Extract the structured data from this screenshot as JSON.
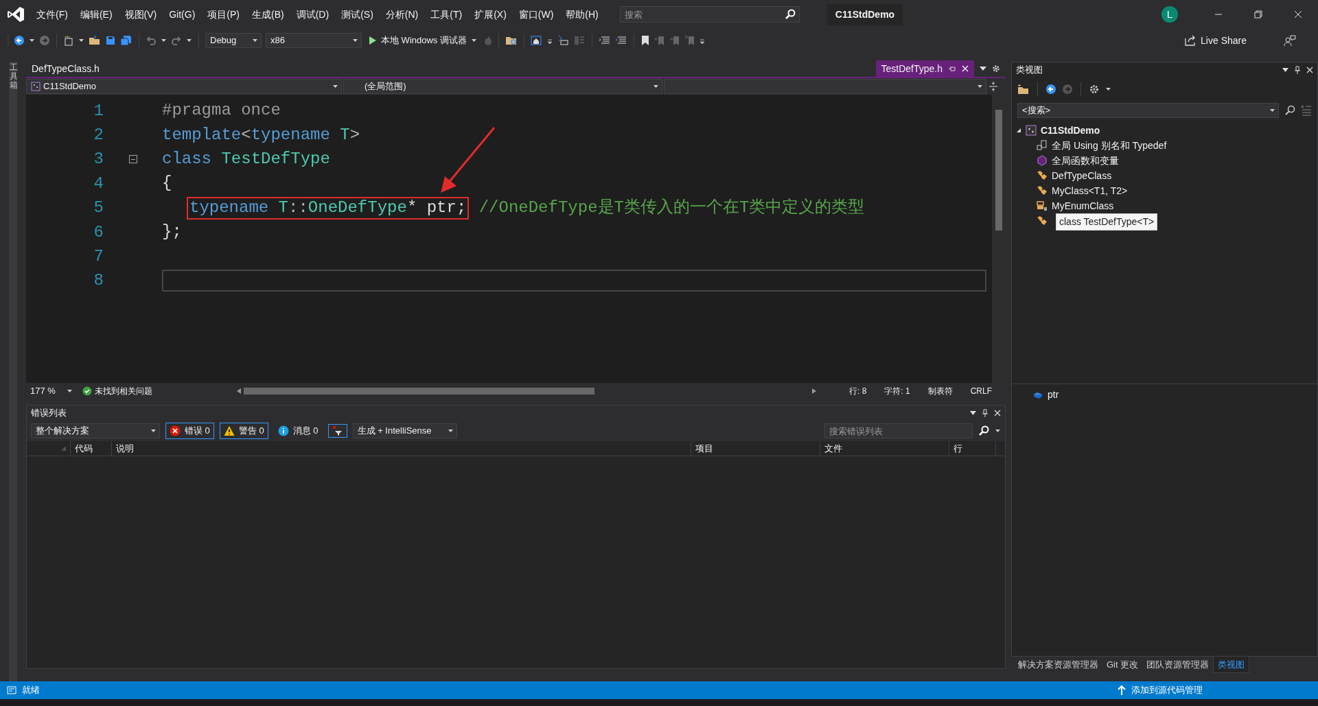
{
  "menu": [
    "文件(F)",
    "编辑(E)",
    "视图(V)",
    "Git(G)",
    "项目(P)",
    "生成(B)",
    "调试(D)",
    "测试(S)",
    "分析(N)",
    "工具(T)",
    "扩展(X)",
    "窗口(W)",
    "帮助(H)"
  ],
  "search": {
    "placeholder": "搜索"
  },
  "solution_title": "C11StdDemo",
  "account": {
    "initial": "L"
  },
  "toolbar": {
    "configuration": "Debug",
    "platform": "x86",
    "run_label": "本地 Windows 调试器",
    "live_share": "Live Share"
  },
  "toolbox_label": "工具箱",
  "editor": {
    "tabs": [
      {
        "label": "DefTypeClass.h",
        "selected": false
      },
      {
        "label": "TestDefType.h",
        "selected": true
      }
    ],
    "nav": [
      "C11StdDemo",
      "(全局范围)"
    ],
    "lines": [
      {
        "number": "1",
        "fold": false,
        "current": false,
        "segments": [
          {
            "boxed": false,
            "tokens": [
              {
                "text": "#pragma once",
                "kind": "pre"
              }
            ]
          }
        ]
      },
      {
        "number": "2",
        "fold": false,
        "current": false,
        "segments": [
          {
            "boxed": false,
            "tokens": [
              {
                "text": "template",
                "kind": "kw"
              },
              {
                "text": "<",
                "kind": "op"
              },
              {
                "text": "typename",
                "kind": "kw"
              },
              {
                "text": " T",
                "kind": "type"
              },
              {
                "text": ">",
                "kind": "op"
              }
            ]
          }
        ]
      },
      {
        "number": "3",
        "fold": true,
        "current": false,
        "segments": [
          {
            "boxed": false,
            "tokens": [
              {
                "text": "class",
                "kind": "kw"
              },
              {
                "text": " TestDefType",
                "kind": "type"
              }
            ]
          }
        ]
      },
      {
        "number": "4",
        "fold": false,
        "current": false,
        "segments": [
          {
            "boxed": false,
            "tokens": [
              {
                "text": "{",
                "kind": "plain"
              }
            ]
          }
        ]
      },
      {
        "number": "5",
        "fold": false,
        "current": false,
        "segments": [
          {
            "boxed": true,
            "tokens": [
              {
                "text": "typename",
                "kind": "kw"
              },
              {
                "text": " T",
                "kind": "type"
              },
              {
                "text": "::",
                "kind": "op"
              },
              {
                "text": "OneDefType",
                "kind": "type"
              },
              {
                "text": "* ptr;",
                "kind": "plain"
              }
            ]
          },
          {
            "boxed": false,
            "tokens": [
              {
                "text": " //OneDefType是T类传入的一个在T类中定义的类型",
                "kind": "comment"
              }
            ]
          }
        ]
      },
      {
        "number": "6",
        "fold": false,
        "current": false,
        "segments": [
          {
            "boxed": false,
            "tokens": [
              {
                "text": "};",
                "kind": "plain"
              }
            ]
          }
        ]
      },
      {
        "number": "7",
        "fold": false,
        "current": false
      },
      {
        "number": "8",
        "fold": false,
        "current": true
      }
    ],
    "zoom": "177 %",
    "issues": "未找到相关问题",
    "position": [
      "行: 8",
      "字符: 1",
      "制表符",
      "CRLF"
    ]
  },
  "error_list": {
    "title": "错误列表",
    "scope": "整个解决方案",
    "filters": [
      {
        "kind": "error",
        "label": "错误 0",
        "selected": true
      },
      {
        "kind": "warning",
        "label": "警告 0",
        "selected": true
      },
      {
        "kind": "info",
        "label": "消息 0",
        "selected": false
      }
    ],
    "source": "生成 + IntelliSense",
    "search": {
      "placeholder": "搜索错误列表"
    },
    "columns": [
      "代码",
      "说明",
      "项目",
      "文件",
      "行"
    ]
  },
  "class_view": {
    "title": "类视图",
    "search": "<搜索>",
    "tree": {
      "label": "C11StdDemo",
      "expanded": true,
      "children": [
        {
          "label": "全局 Using 别名和 Typedef",
          "kind": "typedef"
        },
        {
          "label": "全局函数和变量",
          "kind": "globals"
        },
        {
          "label": "DefTypeClass",
          "kind": "class"
        },
        {
          "label": "MyClass<T1, T2>",
          "kind": "class"
        },
        {
          "label": "MyEnumClass",
          "kind": "enum"
        },
        {
          "kind": "class"
        }
      ]
    },
    "tooltip": "class TestDefType<T>",
    "members": [
      {
        "label": "ptr",
        "kind": "field"
      }
    ]
  },
  "panel_tabs": [
    {
      "label": "解决方案资源管理器",
      "selected": false
    },
    {
      "label": "Git 更改",
      "selected": false
    },
    {
      "label": "团队资源管理器",
      "selected": false
    },
    {
      "label": "类视图",
      "selected": true
    }
  ],
  "status": {
    "text": "就绪",
    "source_control": "添加到源代码管理"
  }
}
